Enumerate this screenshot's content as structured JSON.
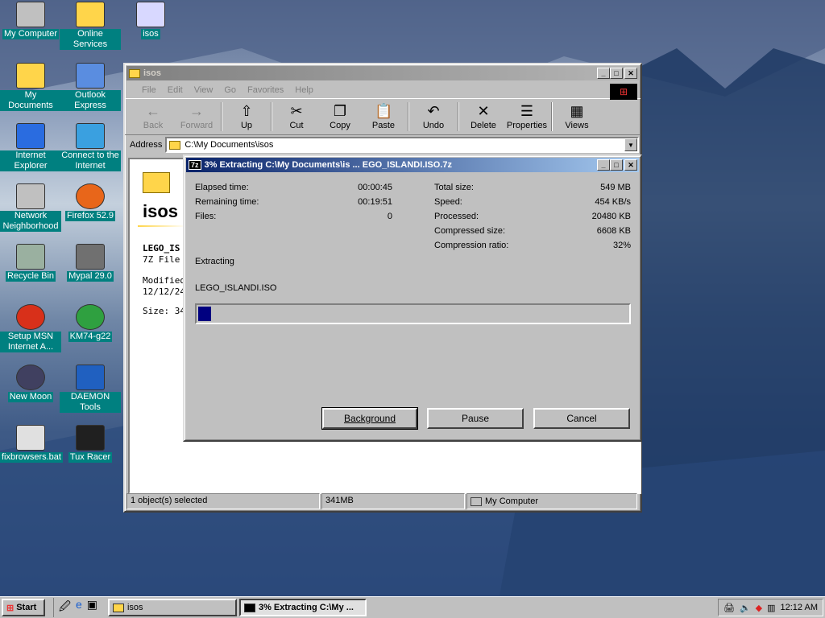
{
  "desktop": {
    "icons": [
      {
        "label": "My Computer",
        "icon": "computer-icon"
      },
      {
        "label": "Online Services",
        "icon": "folder-icon"
      },
      {
        "label": "isos",
        "icon": "cd-shortcut-icon"
      },
      {
        "label": "My Documents",
        "icon": "documents-folder-icon"
      },
      {
        "label": "Outlook Express",
        "icon": "outlook-icon"
      },
      {
        "label": "Internet Explorer",
        "icon": "ie-icon"
      },
      {
        "label": "Connect to the Internet",
        "icon": "connect-icon"
      },
      {
        "label": "Network Neighborhood",
        "icon": "network-icon"
      },
      {
        "label": "Firefox 52.9",
        "icon": "firefox-icon"
      },
      {
        "label": "Recycle Bin",
        "icon": "recycle-bin-icon"
      },
      {
        "label": "Mypal 29.0",
        "icon": "mypal-icon"
      },
      {
        "label": "Setup MSN Internet A...",
        "icon": "msn-icon"
      },
      {
        "label": "KM74-g22",
        "icon": "km-icon"
      },
      {
        "label": "New Moon",
        "icon": "moon-icon"
      },
      {
        "label": "DAEMON Tools",
        "icon": "daemon-icon"
      },
      {
        "label": "fixbrowsers.bat",
        "icon": "bat-icon"
      },
      {
        "label": "Tux Racer",
        "icon": "tux-icon"
      }
    ]
  },
  "explorer": {
    "title": "isos",
    "menu": [
      "File",
      "Edit",
      "View",
      "Go",
      "Favorites",
      "Help"
    ],
    "toolbar": [
      {
        "label": "Back",
        "glyph": "←"
      },
      {
        "label": "Forward",
        "glyph": "→"
      },
      {
        "label": "Up",
        "glyph": "⇧"
      },
      {
        "label": "Cut",
        "glyph": "✂"
      },
      {
        "label": "Copy",
        "glyph": "❐"
      },
      {
        "label": "Paste",
        "glyph": "📋"
      },
      {
        "label": "Undo",
        "glyph": "↶"
      },
      {
        "label": "Delete",
        "glyph": "✕"
      },
      {
        "label": "Properties",
        "glyph": "☰"
      },
      {
        "label": "Views",
        "glyph": "▦"
      }
    ],
    "address_label": "Address",
    "address_value": "C:\\My Documents\\isos",
    "panel": {
      "folder_title": "isos",
      "file_name": "LEGO_IS",
      "file_type": "7Z File",
      "modified_label": "Modified:",
      "modified_value": "12/12/24",
      "size_label": "Size: 349"
    },
    "status": {
      "selected": "1 object(s) selected",
      "size": "341MB",
      "zone": "My Computer"
    }
  },
  "dialog": {
    "title": "3% Extracting C:\\My Documents\\is ... EGO_ISLANDI.ISO.7z",
    "app_badge": "7z",
    "elapsed_label": "Elapsed time:",
    "elapsed_value": "00:00:45",
    "remaining_label": "Remaining time:",
    "remaining_value": "00:19:51",
    "files_label": "Files:",
    "files_value": "0",
    "total_label": "Total size:",
    "total_value": "549 MB",
    "speed_label": "Speed:",
    "speed_value": "454 KB/s",
    "processed_label": "Processed:",
    "processed_value": "20480 KB",
    "compressed_label": "Compressed size:",
    "compressed_value": "6608 KB",
    "ratio_label": "Compression ratio:",
    "ratio_value": "32%",
    "action": "Extracting",
    "current_file": "LEGO_ISLANDI.ISO",
    "progress_percent": 3,
    "buttons": {
      "background": "Background",
      "pause": "Pause",
      "cancel": "Cancel"
    }
  },
  "taskbar": {
    "start": "Start",
    "tasks": [
      {
        "label": "isos",
        "pressed": false
      },
      {
        "label": "3% Extracting C:\\My ...",
        "pressed": true
      }
    ],
    "clock": "12:12 AM"
  },
  "colors": {
    "desktop_teal": "#008080",
    "title_active": "#0a246a",
    "progress": "#000080"
  }
}
